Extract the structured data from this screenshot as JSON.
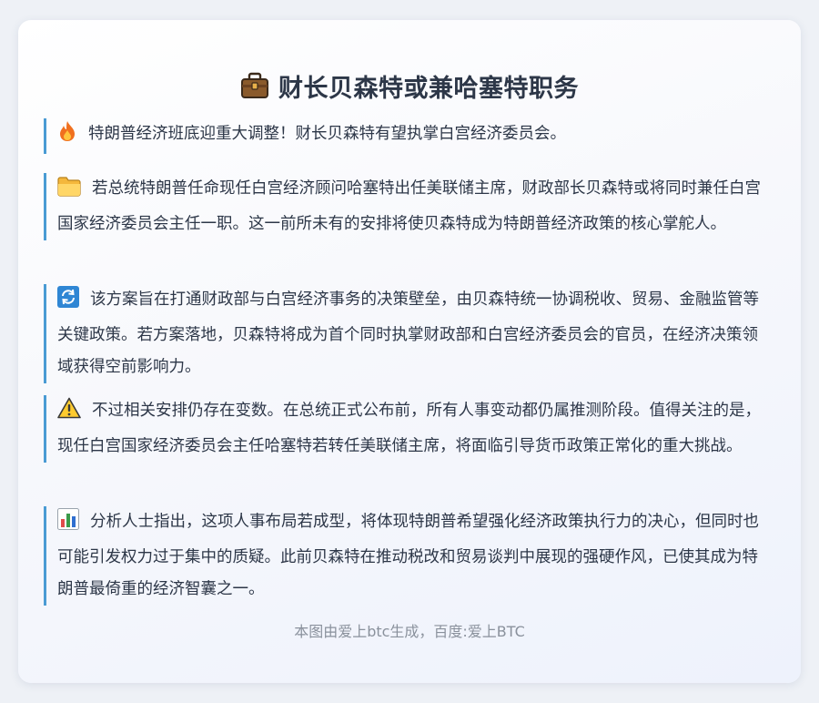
{
  "title": {
    "icon": "briefcase-icon",
    "text": "财长贝森特或兼哈塞特职务"
  },
  "paragraphs": [
    {
      "icon": "fire-icon",
      "text": "特朗普经济班底迎重大调整！财长贝森特有望执掌白宫经济委员会。"
    },
    {
      "icon": "folder-icon",
      "text": "若总统特朗普任命现任白宫经济顾问哈塞特出任美联储主席，财政部长贝森特或将同时兼任白宫国家经济委员会主任一职。这一前所未有的安排将使贝森特成为特朗普经济政策的核心掌舵人。"
    },
    {
      "icon": "refresh-icon",
      "text": "该方案旨在打通财政部与白宫经济事务的决策壁垒，由贝森特统一协调税收、贸易、金融监管等关键政策。若方案落地，贝森特将成为首个同时执掌财政部和白宫经济委员会的官员，在经济决策领域获得空前影响力。"
    },
    {
      "icon": "warning-icon",
      "text": "不过相关安排仍存在变数。在总统正式公布前，所有人事变动都仍属推测阶段。值得关注的是，现任白宫国家经济委员会主任哈塞特若转任美联储主席，将面临引导货币政策正常化的重大挑战。"
    },
    {
      "icon": "bar-chart-icon",
      "text": "分析人士指出，这项人事布局若成型，将体现特朗普希望强化经济政策执行力的决心，但同时也可能引发权力过于集中的质疑。此前贝森特在推动税改和贸易谈判中展现的强硬作风，已使其成为特朗普最倚重的经济智囊之一。"
    }
  ],
  "footer": "本图由爱上btc生成，百度:爱上BTC"
}
